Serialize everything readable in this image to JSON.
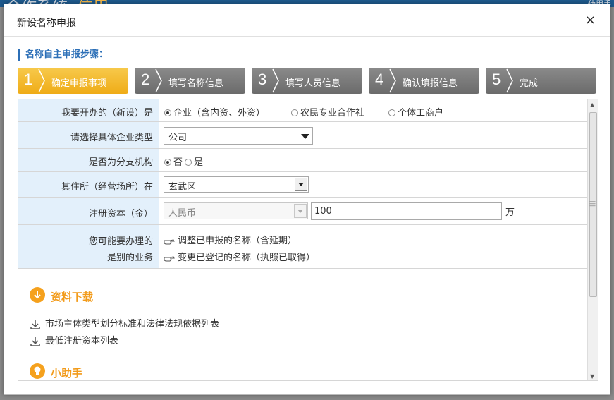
{
  "background": {
    "header_text": "合作系统",
    "header_orange": "信用",
    "login_text": "使用手"
  },
  "dialog": {
    "title": "新设名称申报",
    "close_label": "×"
  },
  "steps": {
    "heading": "名称自主申报步骤：",
    "items": [
      {
        "num": "1",
        "label": "确定申报事项",
        "active": true
      },
      {
        "num": "2",
        "label": "填写名称信息",
        "active": false
      },
      {
        "num": "3",
        "label": "填写人员信息",
        "active": false
      },
      {
        "num": "4",
        "label": "确认填报信息",
        "active": false
      },
      {
        "num": "5",
        "label": "完成",
        "active": false
      }
    ]
  },
  "form": {
    "open_type": {
      "label": "我要开办的（新设）是",
      "options": [
        "企业（含内资、外资）",
        "农民专业合作社",
        "个体工商户"
      ],
      "selected": "企业（含内资、外资）"
    },
    "company_type": {
      "label": "请选择具体企业类型",
      "value": "公司"
    },
    "branch": {
      "label": "是否为分支机构",
      "options": [
        "否",
        "是"
      ],
      "selected": "否"
    },
    "residence": {
      "label": "其住所（经营场所）在",
      "value": "玄武区"
    },
    "capital": {
      "label": "注册资本（金）",
      "currency": "人民币",
      "amount": "100",
      "unit": "万"
    },
    "other_business": {
      "label_line1": "您可能要办理的",
      "label_line2": "是别的业务",
      "links": [
        "调整已申报的名称（含延期）",
        "变更已登记的名称（执照已取得）"
      ]
    }
  },
  "downloads": {
    "title": "资料下载",
    "items": [
      "市场主体类型划分标准和法律法规依据列表",
      "最低注册资本列表"
    ]
  },
  "helper": {
    "title": "小助手"
  },
  "colors": {
    "accent_blue": "#2c6fb7",
    "step_active": "#f2b52a",
    "step_inactive": "#7a7a7a",
    "label_bg": "#e3f0fb",
    "section_orange": "#f29b1a"
  }
}
